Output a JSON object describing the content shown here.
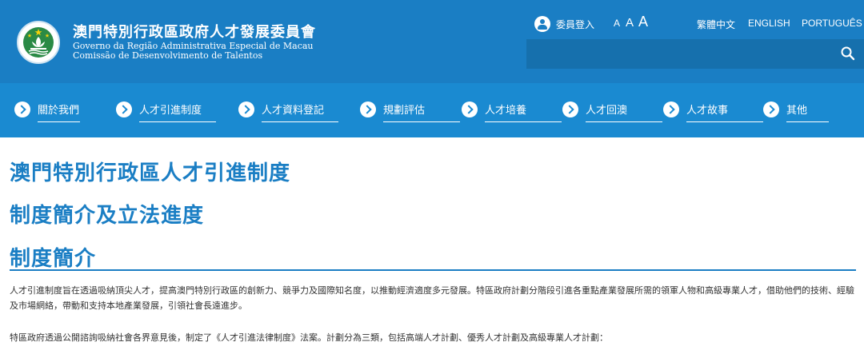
{
  "header": {
    "title": "澳門特別行政區政府人才發展委員會",
    "subtitle_pt_1": "Governo da Região Administrativa Especial de Macau",
    "subtitle_pt_2": "Comissão de Desenvolvimento de Talentos",
    "login_label": "委員登入",
    "font_sizes": [
      "A",
      "A",
      "A"
    ],
    "languages": [
      "繁體中文",
      "ENGLISH",
      "PORTUGUÊS"
    ],
    "search": {
      "value": "",
      "placeholder": ""
    },
    "colors": {
      "header_bg": "#1a7ec4",
      "nav_bg": "#1a8ad1"
    }
  },
  "nav": {
    "items": [
      {
        "label": "關於我們",
        "icon": "arrow-right-circle-icon"
      },
      {
        "label": "人才引進制度",
        "icon": "arrow-right-circle-icon"
      },
      {
        "label": "人才資料登記",
        "icon": "arrow-right-circle-icon"
      },
      {
        "label": "規劃評估",
        "icon": "arrow-right-circle-icon"
      },
      {
        "label": "人才培養",
        "icon": "arrow-right-circle-icon"
      },
      {
        "label": "人才回澳",
        "icon": "arrow-right-circle-icon"
      },
      {
        "label": "人才故事",
        "icon": "arrow-right-circle-icon"
      },
      {
        "label": "其他",
        "icon": "arrow-right-circle-icon"
      }
    ]
  },
  "main": {
    "title": "澳門特別行政區人才引進制度",
    "subtitle": "制度簡介及立法進度",
    "section_title": "制度簡介",
    "paragraphs": [
      "人才引進制度旨在透過吸納頂尖人才，提高澳門特別行政區的創新力、競爭力及國際知名度，以推動經濟適度多元發展。特區政府計劃分階段引進各重點產業發展所需的領軍人物和高級專業人才，借助他們的技術、經驗及市場網絡，帶動和支持本地產業發展，引領社會長遠進步。",
      "特區政府透過公開諮詢吸納社會各界意見後，制定了《人才引進法律制度》法案。計劃分為三類，包括高端人才計劃、優秀人才計劃及高級專業人才計劃："
    ]
  }
}
